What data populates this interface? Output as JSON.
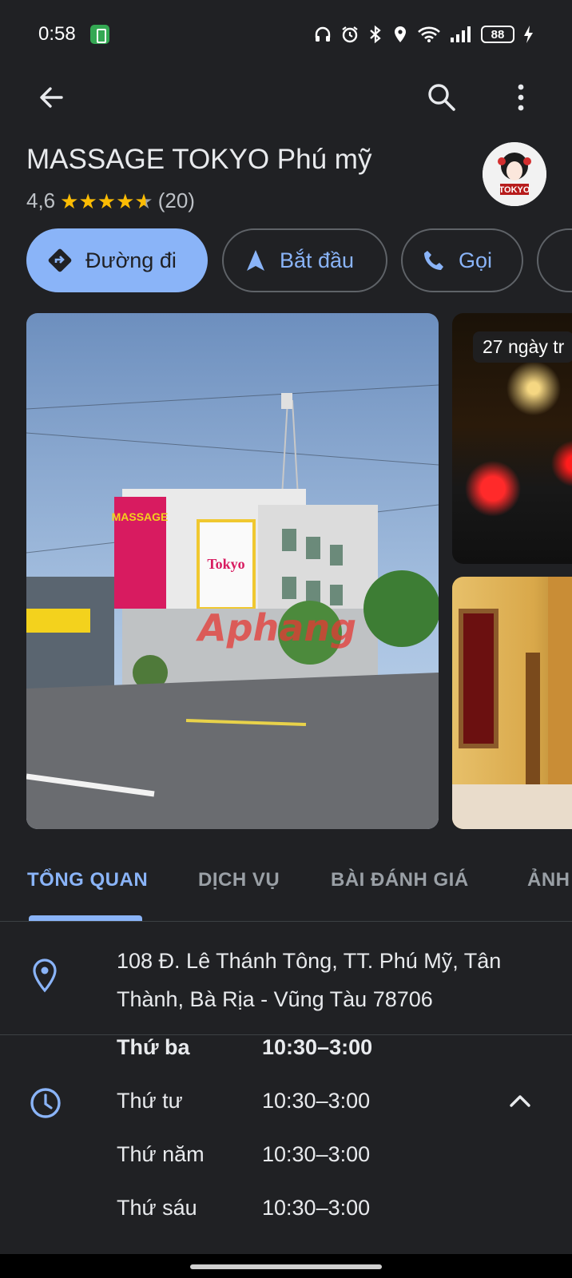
{
  "status": {
    "time": "0:58",
    "battery": "88"
  },
  "place": {
    "name": "MASSAGE TOKYO Phú mỹ",
    "rating": "4,6",
    "stars_value": 4.6,
    "review_count": "(20)",
    "logo_text": "TOKYO"
  },
  "actions": [
    {
      "label": "Đường đi",
      "icon": "directions-icon"
    },
    {
      "label": "Bắt đầu",
      "icon": "navigation-arrow-icon"
    },
    {
      "label": "Gọi",
      "icon": "phone-icon"
    }
  ],
  "photos": {
    "side_badge": "27 ngày tr",
    "sign_text": "MASSAGE",
    "sign_text2": "Tokyo",
    "watermark": "Aphang"
  },
  "tabs": [
    "TỔNG QUAN",
    "DỊCH VỤ",
    "BÀI ĐÁNH GIÁ",
    "ẢNH"
  ],
  "address": {
    "line1": "108 Đ. Lê Thánh Tông, TT. Phú Mỹ, Tân",
    "line2": "Thành, Bà Rịa - Vũng Tàu 78706"
  },
  "hours": [
    {
      "day": "Thứ ba",
      "time": "10:30–3:00"
    },
    {
      "day": "Thứ tư",
      "time": "10:30–3:00"
    },
    {
      "day": "Thứ năm",
      "time": "10:30–3:00"
    },
    {
      "day": "Thứ sáu",
      "time": "10:30–3:00"
    }
  ],
  "colors": {
    "accent": "#8ab4f8",
    "star": "#fbbc04",
    "background": "#202124"
  }
}
